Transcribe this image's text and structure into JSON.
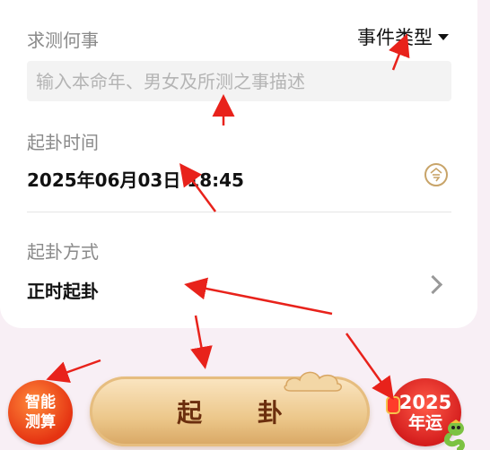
{
  "question": {
    "label": "求测何事",
    "event_type": "事件类型",
    "placeholder": "输入本命年、男女及所测之事描述"
  },
  "time": {
    "label": "起卦时间",
    "value": "2025年06月03日 18:45"
  },
  "method": {
    "label": "起卦方式",
    "value": "正时起卦"
  },
  "buttons": {
    "smart_line1": "智能",
    "smart_line2": "测算",
    "divine": "起 卦",
    "fortune_year": "2025",
    "fortune_text": "年运"
  },
  "colors": {
    "accent": "#d41d1d",
    "gold": "#c8a469",
    "annotation_red": "#e8221b"
  }
}
